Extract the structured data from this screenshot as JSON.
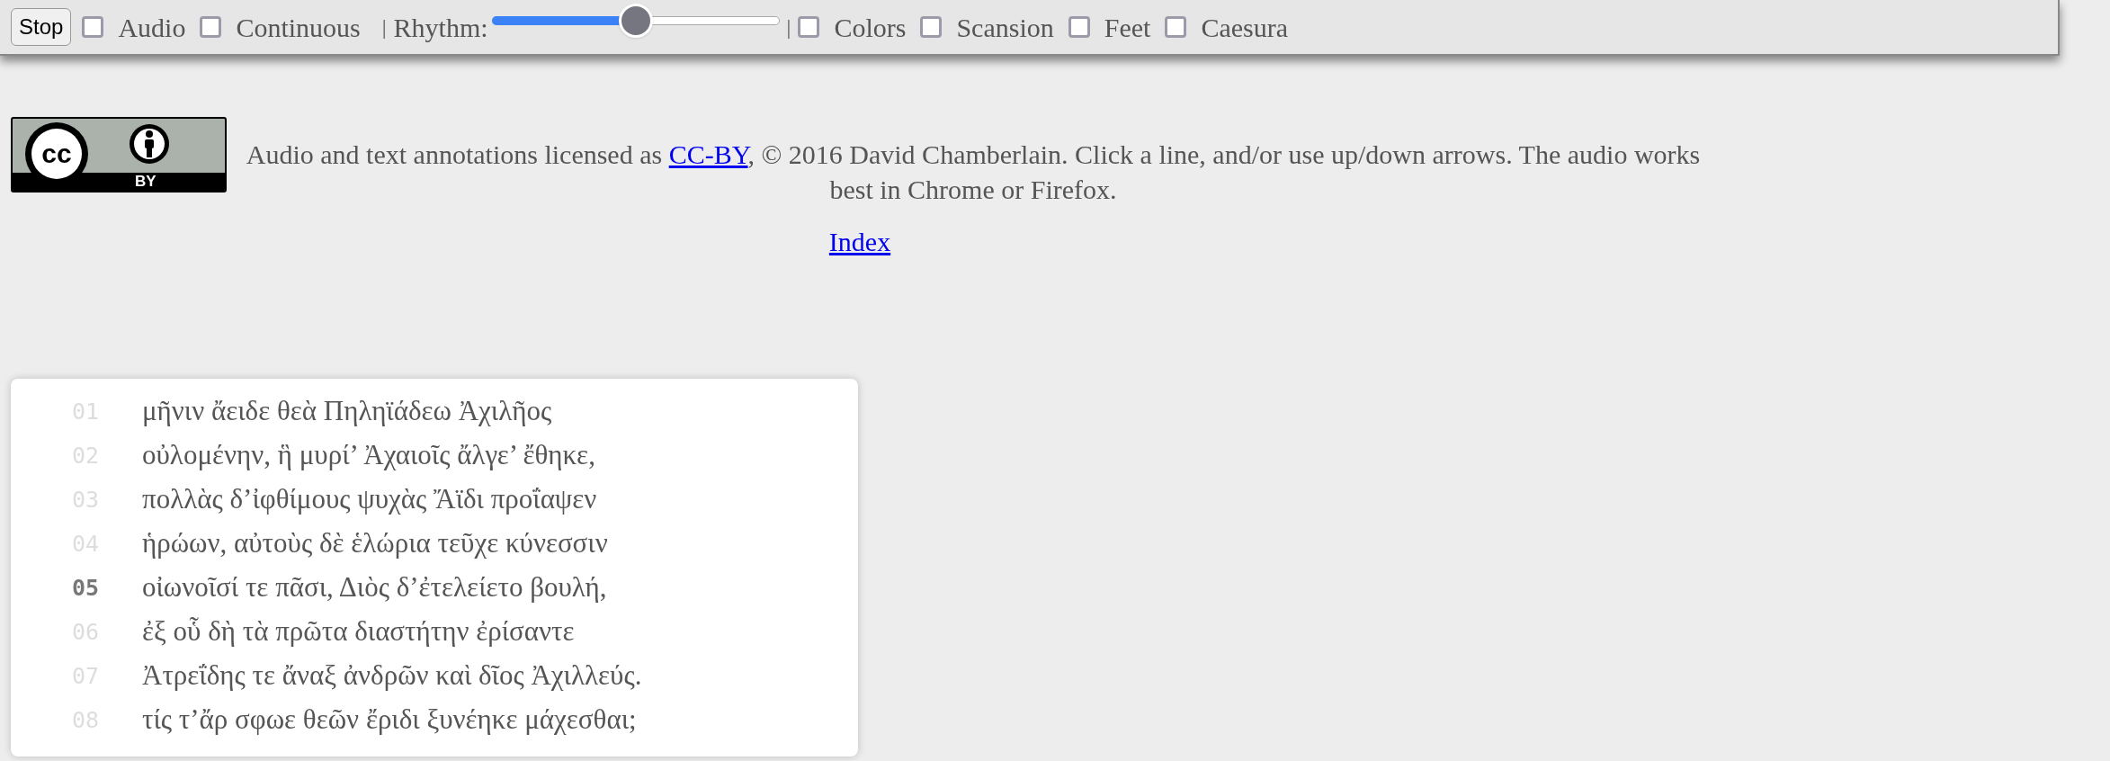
{
  "toolbar": [
    {
      "kind": "button",
      "label": "Stop"
    },
    {
      "kind": "checkbox",
      "label": "Audio",
      "checked": false
    },
    {
      "kind": "checkbox",
      "label": "Continuous",
      "checked": false
    },
    {
      "kind": "separator",
      "label": "|"
    },
    {
      "kind": "label",
      "label": "Rhythm:"
    },
    {
      "kind": "slider",
      "level": 0.5
    },
    {
      "kind": "separator",
      "label": "|"
    },
    {
      "kind": "checkbox",
      "label": "Colors",
      "checked": false
    },
    {
      "kind": "checkbox",
      "label": "Scansion",
      "checked": false
    },
    {
      "kind": "checkbox",
      "label": "Feet",
      "checked": false
    },
    {
      "kind": "checkbox",
      "label": "Caesura",
      "checked": false
    }
  ],
  "license": {
    "badge_logo": "cc",
    "badge_text": "BY",
    "text_before": "Audio and text annotations licensed as ",
    "link": "CC-BY",
    "text_after": ", © 2016 David Chamberlain. Click a line, and/or use up/down arrows. The audio works best in Chrome or Firefox."
  },
  "index_link": "Index",
  "lines": [
    {
      "number": "01",
      "text": "μῆνιν ἄειδε θεὰ Πηληϊάδεω Ἀχιλῆος",
      "selected": false
    },
    {
      "number": "02",
      "text": "οὐλομένην, ἣ μυρί’ Ἀχαιοῖς ἄλγε’ ἔθηκε,",
      "selected": false
    },
    {
      "number": "03",
      "text": "πολλὰς δ’ἰφθίμους ψυχὰς Ἄϊδι προΐαψεν",
      "selected": false
    },
    {
      "number": "04",
      "text": "ἡρώων, αὐτοὺς δὲ ἑλώρια τεῦχε κύνεσσιν",
      "selected": false
    },
    {
      "number": "05",
      "text": "οἰωνοῖσί τε πᾶσι, Διὸς δ’ἐτελείετο βουλή,",
      "selected": true
    },
    {
      "number": "06",
      "text": "ἐξ οὗ δὴ τὰ πρῶτα διαστήτην ἐρίσαντε",
      "selected": false
    },
    {
      "number": "07",
      "text": "Ἀτρεΐδης τε ἄναξ ἀνδρῶν καὶ δῖος Ἀχιλλεύς.",
      "selected": false
    },
    {
      "number": "08",
      "text": "τίς τ’ἄρ σφωε θεῶν ἔριδι ξυνέηκε μάχεσθαι;",
      "selected": false
    }
  ]
}
